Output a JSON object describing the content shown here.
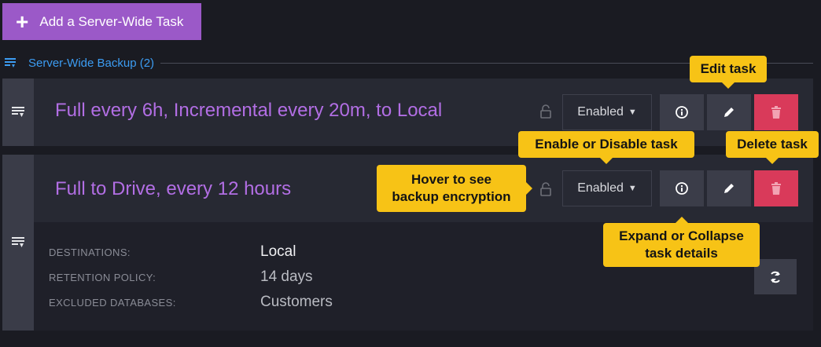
{
  "toolbar": {
    "add_label": "Add a Server-Wide Task"
  },
  "section": {
    "title": "Server-Wide Backup (2)"
  },
  "tasks": [
    {
      "title": "Full every 6h, Incremental every 20m, to Local",
      "state": "Enabled"
    },
    {
      "title": "Full to Drive, every 12 hours",
      "state": "Enabled"
    }
  ],
  "details": {
    "destinations_label": "DESTINATIONS:",
    "destinations_value": "Local",
    "retention_label": "RETENTION POLICY:",
    "retention_value": "14 days",
    "excluded_label": "EXCLUDED DATABASES:",
    "excluded_value": "Customers"
  },
  "callouts": {
    "edit": "Edit task",
    "enable": "Enable or Disable task",
    "delete": "Delete task",
    "hover": "Hover to see backup encryption",
    "expand": "Expand or Collapse task details"
  },
  "colors": {
    "accent_purple": "#9b59c8",
    "title_purple": "#b26ee4",
    "section_blue": "#3c9cf2",
    "delete_red": "#d93a5a",
    "callout_yellow": "#f7c316"
  },
  "icons": [
    "plus-icon",
    "backup-section-icon",
    "backup-task-icon",
    "lock-icon",
    "info-icon",
    "pencil-icon",
    "trash-icon",
    "refresh-icon"
  ]
}
